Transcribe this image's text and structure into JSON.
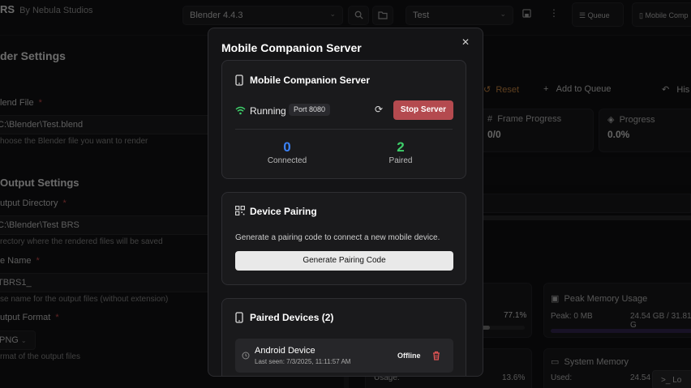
{
  "app": {
    "brand_fragment": "RS",
    "brand_subtitle": "By Nebula Studios",
    "blender_version": "Blender 4.4.3",
    "preset": "Test",
    "queue_label": "Queue",
    "mobile_label": "Mobile Comp"
  },
  "render_settings": {
    "section_title": "der Settings",
    "blend_file_label": "lend File",
    "blend_file_value": "C:\\Blender\\Test.blend",
    "blend_file_help": "hoose the Blender file you want to render",
    "output_section_title": "Output Settings",
    "output_dir_label": "utput Directory",
    "output_dir_value": "C:\\Blender\\Test BRS",
    "output_dir_help": "rectory where the rendered files will be saved",
    "file_name_label": "e Name",
    "file_name_value": "TBRS1_",
    "file_name_help": "se name for the output files (without extension)",
    "output_format_label": "utput Format",
    "output_format_value": "PNG",
    "output_format_help": "rmat of the output files"
  },
  "right_panel": {
    "reset_label": "Reset",
    "add_queue_label": "Add to Queue",
    "history_label": "His",
    "frame_progress_label": "Frame Progress",
    "frame_progress_value": "0/0",
    "progress_label": "Progress",
    "progress_value": "0.0%",
    "cpu_percent": "77.1%",
    "cpu_fraction": 0.771,
    "peak_memory_label": "Peak Memory Usage",
    "peak_memory_value": "Peak: 0 MB",
    "peak_memory_total": "24.54 GB / 31.81 G",
    "usage_label": "Usage:",
    "usage_value": "13.6%",
    "system_memory_label": "System Memory",
    "used_label": "Used:",
    "used_value": "24.54 G",
    "logs_label": "Lo"
  },
  "modal": {
    "title": "Mobile Companion Server",
    "server_card": {
      "title": "Mobile Companion Server",
      "status": "Running",
      "port": "Port 8080",
      "stop_label": "Stop Server",
      "connected_count": "0",
      "connected_label": "Connected",
      "paired_count": "2",
      "paired_label": "Paired"
    },
    "pairing_card": {
      "title": "Device Pairing",
      "description": "Generate a pairing code to connect a new mobile device.",
      "button_label": "Generate Pairing Code"
    },
    "devices_card": {
      "title": "Paired Devices (2)",
      "devices": [
        {
          "name": "Android Device",
          "last_seen": "Last seen: 7/3/2025, 11:11:57 AM",
          "status": "Offline"
        }
      ]
    }
  },
  "colors": {
    "accent_green": "#3ecf6a",
    "accent_blue": "#3b82f6",
    "danger": "#b44a4f",
    "reset_orange": "#e0954a"
  }
}
